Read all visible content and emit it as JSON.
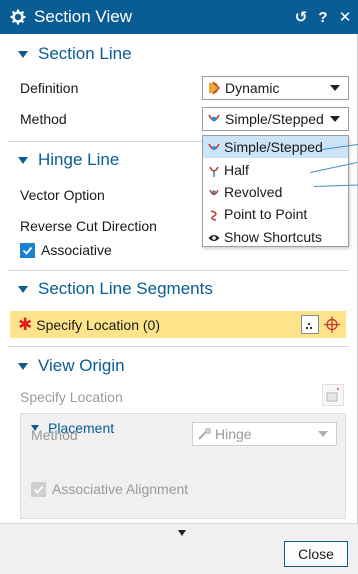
{
  "window": {
    "title": "Section View",
    "reset_symbol": "↺",
    "help_symbol": "?",
    "close_symbol": "✕"
  },
  "section_line": {
    "header": "Section Line",
    "definition_label": "Definition",
    "definition_value": "Dynamic",
    "method_label": "Method",
    "method_value": "Simple/Stepped"
  },
  "method_popup": {
    "items": [
      {
        "label": "Simple/Stepped",
        "icon": "simple-stepped-icon",
        "selected": true
      },
      {
        "label": "Half",
        "icon": "half-icon"
      },
      {
        "label": "Revolved",
        "icon": "revolved-icon"
      },
      {
        "label": "Point to Point",
        "icon": "point-to-point-icon"
      },
      {
        "label": "Show Shortcuts",
        "icon": "eye-icon"
      }
    ]
  },
  "hinge_line": {
    "header": "Hinge Line",
    "vector_option_label": "Vector Option",
    "reverse_cut_label": "Reverse Cut Direction",
    "associative_label": "Associative",
    "associative_checked": true
  },
  "section_line_segments": {
    "header": "Section Line Segments",
    "required_mark": "✱",
    "specify_location_label": "Specify Location (0)"
  },
  "view_origin": {
    "header": "View Origin",
    "specify_location_label": "Specify Location",
    "placement": {
      "header": "Placement",
      "method_label": "Method",
      "method_value": "Hinge",
      "associative_alignment_label": "Associative Alignment",
      "associative_alignment_checked": true
    }
  },
  "footer": {
    "close_label": "Close"
  },
  "colors": {
    "title_bar": "#0a5c94",
    "accent": "#0a5c94",
    "required_highlight": "#fde38a",
    "selected_item": "#cce4f7"
  }
}
